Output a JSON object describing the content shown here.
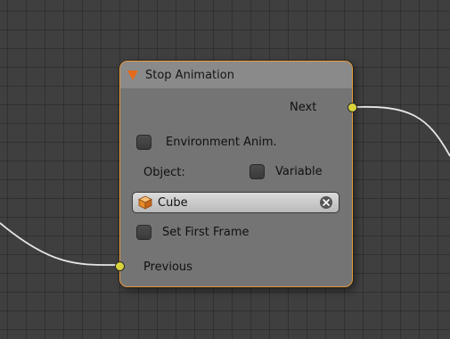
{
  "node": {
    "title": "Stop Animation",
    "header_color": "#8a8a8a",
    "border_color": "#e79a3a",
    "collapse_icon": "triangle-down-icon"
  },
  "sockets": {
    "output_label": "Next",
    "input_label": "Previous",
    "socket_color": "#d9d33a"
  },
  "options": {
    "environment_anim_label": "Environment Anim.",
    "object_label": "Object:",
    "variable_label": "Variable",
    "object_value": "Cube",
    "object_icon": "cube-icon",
    "clear_icon": "clear-icon",
    "set_first_frame_label": "Set First Frame"
  }
}
